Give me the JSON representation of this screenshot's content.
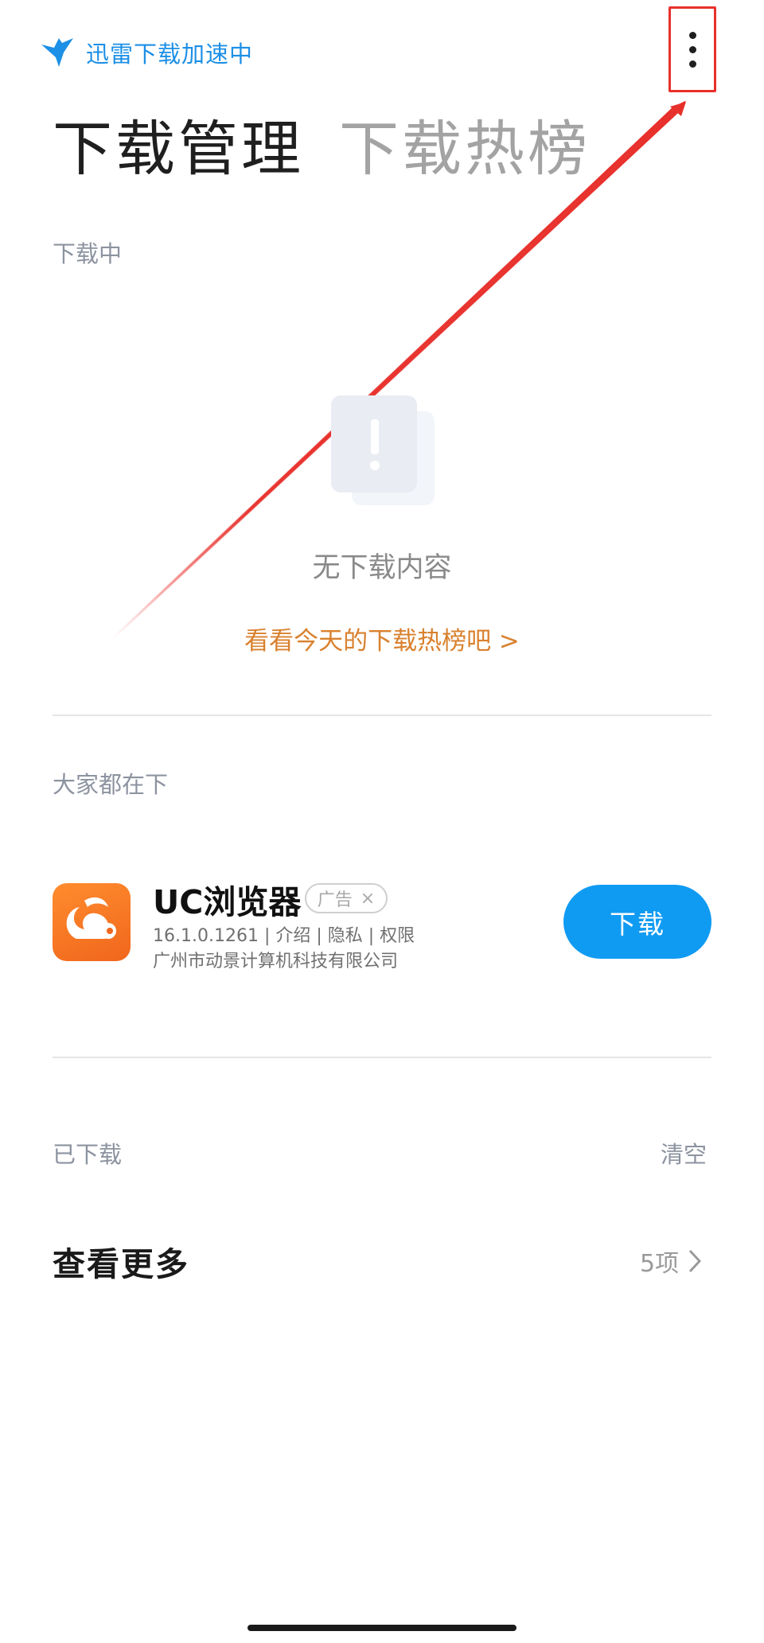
{
  "header": {
    "brand_icon": "bird-logo-icon",
    "brand_text": "迅雷下载加速中",
    "more_icon": "more-vertical-icon",
    "annotation_color": "#e8302b"
  },
  "tabs": [
    {
      "label": "下载管理",
      "active": true
    },
    {
      "label": "下载热榜",
      "active": false
    }
  ],
  "downloading": {
    "section_label": "下载中",
    "empty_icon": "warning-card-icon",
    "empty_text": "无下载内容",
    "hot_link": "看看今天的下载热榜吧 >"
  },
  "popular": {
    "section_label": "大家都在下",
    "app": {
      "name": "UC浏览器",
      "ad_badge": "广告",
      "ad_close": "×",
      "meta": "16.1.0.1261 | 介绍 | 隐私 | 权限",
      "company": "广州市动景计算机科技有限公司",
      "download_label": "下载",
      "icon": "uc-browser-squirrel-icon"
    }
  },
  "downloaded": {
    "section_label": "已下载",
    "clear_label": "清空",
    "see_more_label": "查看更多",
    "count": "5项",
    "chevron_icon": "chevron-right-icon"
  },
  "colors": {
    "brand_blue": "#1c8fe6",
    "download_button": "#109bf3",
    "link_orange": "#d9812e"
  }
}
